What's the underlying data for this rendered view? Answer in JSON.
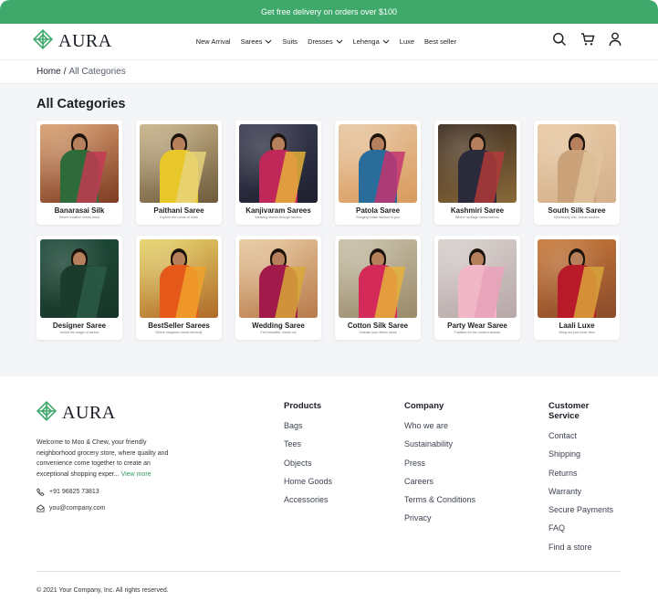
{
  "promo": {
    "text": "Get free delivery on orders over $100"
  },
  "brand": {
    "name": "AURA"
  },
  "nav": {
    "items": [
      {
        "label": "New Arrival"
      },
      {
        "label": "Sarees"
      },
      {
        "label": "Suits"
      },
      {
        "label": "Dresses"
      },
      {
        "label": "Lehenga"
      },
      {
        "label": "Luxe"
      },
      {
        "label": "Best seller"
      }
    ],
    "icons": [
      "search-icon",
      "cart-icon",
      "user-icon"
    ]
  },
  "breadcrumb": {
    "home": "Home",
    "separator": "/",
    "current": "All Categories"
  },
  "categories": {
    "title": "All Categories",
    "items": [
      {
        "name": "Banarasai Silk",
        "tagline": "Where tradition meets trend"
      },
      {
        "name": "Paithani Saree",
        "tagline": "Explore the colors of India"
      },
      {
        "name": "Kanjivaram Sarees",
        "tagline": "Weaving stories through fashion"
      },
      {
        "name": "Patola Saree",
        "tagline": "Bringing Indian fashion to you"
      },
      {
        "name": "Kashmiri Saree",
        "tagline": "Where heritage meets fashion"
      },
      {
        "name": "South Silk Saree",
        "tagline": "Effortlessly chic, Indian couture"
      },
      {
        "name": "Designer Saree",
        "tagline": "Unfold the magic of sarees"
      },
      {
        "name": "BestSeller Sarees",
        "tagline": "Where elegance meets ethnicity"
      },
      {
        "name": "Wedding Saree",
        "tagline": "Feel beautiful, inside out"
      },
      {
        "name": "Cotton Silk Saree",
        "tagline": "Unleash your ethnic allure"
      },
      {
        "name": "Party Wear Saree",
        "tagline": "Tradition for the modern woman"
      },
      {
        "name": "Laali Luxe",
        "tagline": "Bring out your inner diva"
      }
    ]
  },
  "footer": {
    "about": "Welcome to Moo & Chew, your friendly neighborhood grocery store, where quality and convenience come together to create an exceptional shopping exper...",
    "view_more": "View more",
    "phone": "+91 96825 73813",
    "email": "you@company.com",
    "products": {
      "title": "Products",
      "links": [
        "Bags",
        "Tees",
        "Objects",
        "Home Goods",
        "Accessories"
      ]
    },
    "company": {
      "title": "Company",
      "links": [
        "Who we are",
        "Sustainability",
        "Press",
        "Careers",
        "Terms & Conditions",
        "Privacy"
      ]
    },
    "service": {
      "title": "Customer Service",
      "links": [
        "Contact",
        "Shipping",
        "Returns",
        "Warranty",
        "Secure Payments",
        "FAQ",
        "Find a store"
      ]
    },
    "copyright": "© 2021 Your Company, Inc. All rights reserved."
  },
  "colors": {
    "accent": "#3fa96b",
    "link_green": "#2f9a5c",
    "section_bg": "#f4f5f7"
  }
}
